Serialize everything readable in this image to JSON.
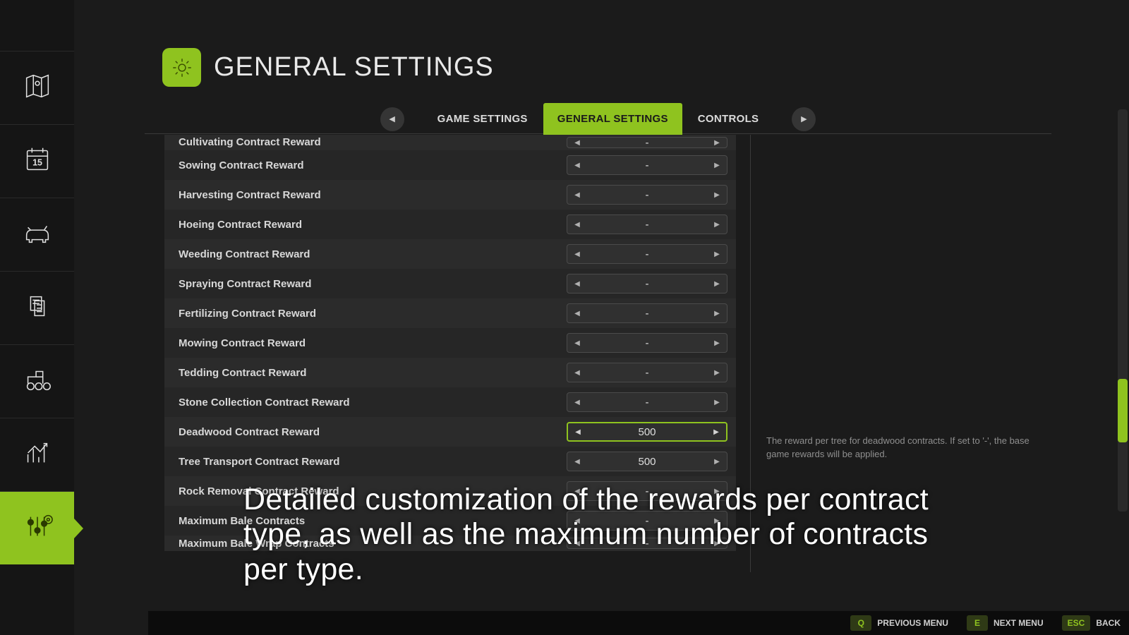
{
  "header": {
    "title": "GENERAL SETTINGS"
  },
  "tabs": {
    "items": [
      {
        "label": "GAME SETTINGS",
        "active": false
      },
      {
        "label": "GENERAL SETTINGS",
        "active": true
      },
      {
        "label": "CONTROLS",
        "active": false
      }
    ],
    "prev_glyph": "◀",
    "next_glyph": "▶"
  },
  "rows": [
    {
      "label": "Cultivating Contract Reward",
      "value": "-",
      "selected": false,
      "clip": "top"
    },
    {
      "label": "Sowing Contract Reward",
      "value": "-",
      "selected": false
    },
    {
      "label": "Harvesting Contract Reward",
      "value": "-",
      "selected": false
    },
    {
      "label": "Hoeing Contract Reward",
      "value": "-",
      "selected": false
    },
    {
      "label": "Weeding Contract Reward",
      "value": "-",
      "selected": false
    },
    {
      "label": "Spraying Contract Reward",
      "value": "-",
      "selected": false
    },
    {
      "label": "Fertilizing Contract Reward",
      "value": "-",
      "selected": false
    },
    {
      "label": "Mowing Contract Reward",
      "value": "-",
      "selected": false
    },
    {
      "label": "Tedding Contract Reward",
      "value": "-",
      "selected": false
    },
    {
      "label": "Stone Collection Contract Reward",
      "value": "-",
      "selected": false
    },
    {
      "label": "Deadwood Contract Reward",
      "value": "500",
      "selected": true
    },
    {
      "label": "Tree Transport Contract Reward",
      "value": "500",
      "selected": false
    },
    {
      "label": "Rock Removal Contract Reward",
      "value": "-",
      "selected": false
    },
    {
      "label": "Maximum Bale Contracts",
      "value": "-",
      "selected": false
    },
    {
      "label": "Maximum Bale Wrap Contracts",
      "value": "-",
      "selected": false,
      "clip": "bottom"
    }
  ],
  "arrows": {
    "left": "◀",
    "right": "▶"
  },
  "description": "The reward per tree for deadwood contracts. If set to '-', the base game rewards will be applied.",
  "caption": "Detailed customization of the rewards per contract type, as well as the maximum number of contracts per type.",
  "footer": [
    {
      "key": "Q",
      "label": "PREVIOUS MENU"
    },
    {
      "key": "E",
      "label": "NEXT MENU"
    },
    {
      "key": "ESC",
      "label": "BACK"
    }
  ],
  "sidebar": {
    "items": [
      {
        "name": "map-icon"
      },
      {
        "name": "calendar-icon"
      },
      {
        "name": "animals-icon"
      },
      {
        "name": "contracts-icon"
      },
      {
        "name": "vehicles-icon"
      },
      {
        "name": "statistics-icon"
      },
      {
        "name": "settings-icon",
        "active": true
      }
    ]
  }
}
